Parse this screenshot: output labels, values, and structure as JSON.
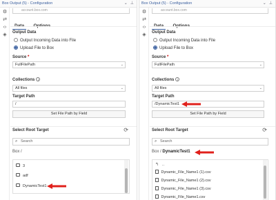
{
  "left": {
    "window_title": "Box Output (5) - Configuration",
    "url_text": "account.box.com",
    "tabs": [
      "Data",
      "Options"
    ],
    "output_data_label": "Output Data",
    "radio_output_incoming": "Output Incoming Data into File",
    "radio_upload": "Upload File to Box",
    "source_label": "Source",
    "source_value": "FullFilePath",
    "collections_label": "Collections",
    "collections_value": "All files",
    "target_path_label": "Target Path",
    "target_path_value": "/",
    "set_file_path_label": "Set File Path by Field",
    "root_target_label": "Select Root Target",
    "search_placeholder": "Search",
    "breadcrumb_root": "Box /",
    "breadcrumb_current": "",
    "items": [
      {
        "name": "3",
        "kind": "folder"
      },
      {
        "name": "adf",
        "kind": "folder"
      },
      {
        "name": "DynamicTest1",
        "kind": "folder"
      }
    ]
  },
  "right": {
    "window_title": "Box Output (5) - Configuration",
    "url_text": "account.box.com",
    "tabs": [
      "Data",
      "Options"
    ],
    "output_data_label": "Output Data",
    "radio_output_incoming": "Output Incoming Data into File",
    "radio_upload": "Upload File to Box",
    "source_label": "Source",
    "source_value": "FullFilePath",
    "collections_label": "Collections",
    "collections_value": "All files",
    "target_path_label": "Target Path",
    "target_path_value": "/DynamicTest1",
    "set_file_path_label": "Set File Path by Field",
    "root_target_label": "Select Root Target",
    "search_placeholder": "Search",
    "breadcrumb_root": "Box /",
    "breadcrumb_current": "DynamicTest1",
    "up_item": "..",
    "items": [
      {
        "name": "Dynamic_File_Name1 (1).csv",
        "kind": "file"
      },
      {
        "name": "Dynamic_File_Name1 (2).csv",
        "kind": "file"
      },
      {
        "name": "Dynamic_File_Name1 (3).csv",
        "kind": "file"
      },
      {
        "name": "Dynamic_File_Name1.csv",
        "kind": "file"
      }
    ]
  },
  "colors": {
    "accent": "#3a5f9f",
    "annotation_arrow": "#e0201b"
  }
}
